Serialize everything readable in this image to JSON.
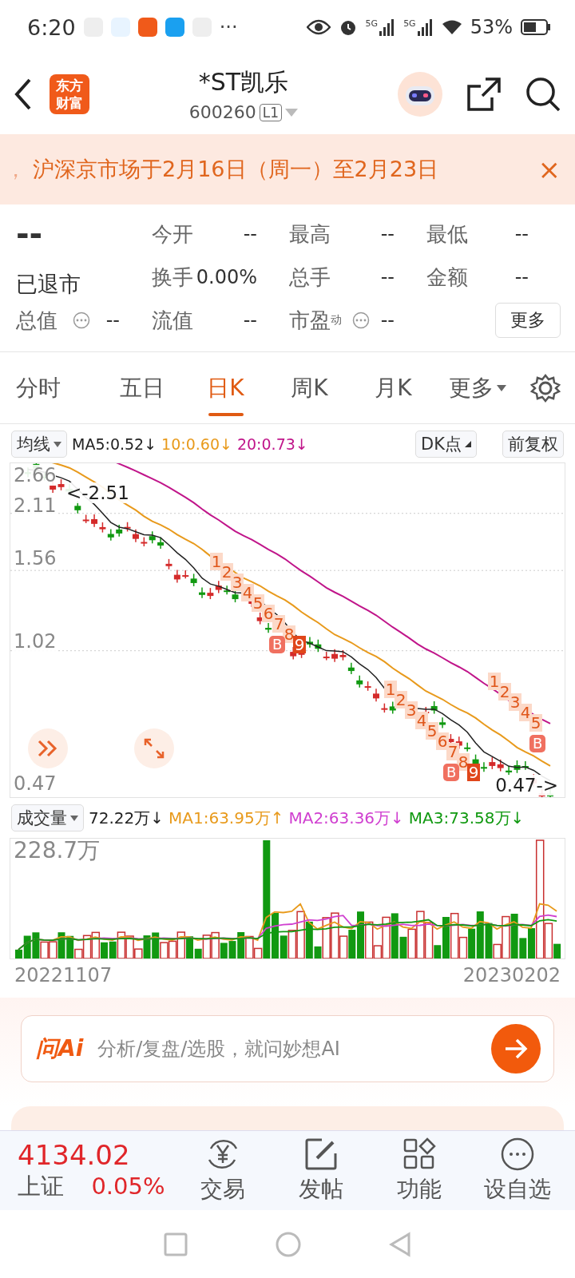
{
  "status_bar": {
    "time": "6:20",
    "more": "···",
    "network_1": "5G",
    "network_2": "5G",
    "battery": "53%"
  },
  "header": {
    "logo": "东方财富",
    "title": "*ST凯乐",
    "code": "600260",
    "level_badge": "L1"
  },
  "notice": {
    "lead": "，",
    "text": "沪深京市场于2月16日（周一）至2月23日",
    "close": "×"
  },
  "quote": {
    "price": "--",
    "status": "已退市",
    "fields": [
      {
        "label": "今开",
        "value": "--"
      },
      {
        "label": "最高",
        "value": "--"
      },
      {
        "label": "最低",
        "value": "--"
      },
      {
        "label": "换手",
        "value": "0.00%"
      },
      {
        "label": "总手",
        "value": "--"
      },
      {
        "label": "金额",
        "value": "--"
      }
    ],
    "row3": [
      {
        "label": "总值",
        "info": true,
        "value": "--"
      },
      {
        "label": "流值",
        "info": false,
        "value": "--"
      },
      {
        "label": "市盈",
        "sup": "动",
        "info": true,
        "value": "--"
      }
    ],
    "more_button": "更多"
  },
  "tabs": [
    {
      "label": "分时",
      "selected": false
    },
    {
      "label": "五日",
      "selected": false
    },
    {
      "label": "日K",
      "selected": true
    },
    {
      "label": "周K",
      "selected": false
    },
    {
      "label": "月K",
      "selected": false
    },
    {
      "label": "更多",
      "selected": false,
      "dropdown": true
    }
  ],
  "ma_bar": {
    "selector": "均线",
    "items": [
      {
        "text": "MA5:0.52↓",
        "color": "#222222"
      },
      {
        "text": "10:0.60↓",
        "color": "#e89a1c"
      },
      {
        "text": "20:0.73↓",
        "color": "#c0158a"
      }
    ],
    "dk_button": "DK点",
    "adjust_button": "前复权"
  },
  "kline": {
    "y_labels": [
      "2.66",
      "2.11",
      "1.56",
      "1.02",
      "0.47"
    ],
    "high_note": "<-2.51",
    "low_note": "0.47->",
    "td_sequences": [
      {
        "labels": [
          "1",
          "2",
          "3",
          "4",
          "5",
          "6",
          "7",
          "8",
          "9"
        ],
        "buy": "B"
      },
      {
        "labels": [
          "1",
          "2",
          "3",
          "4",
          "5",
          "6",
          "7",
          "8",
          "9"
        ],
        "buy": "B"
      },
      {
        "labels": [
          "1",
          "2",
          "3",
          "4",
          "5"
        ],
        "buy": "B"
      }
    ]
  },
  "volume_bar": {
    "selector": "成交量",
    "items": [
      {
        "text": "72.22万↓",
        "color": "#222222"
      },
      {
        "text": "MA1:63.95万↑",
        "color": "#e89a1c"
      },
      {
        "text": "MA2:63.36万↓",
        "color": "#d040d0"
      },
      {
        "text": "MA3:73.58万↓",
        "color": "#119911"
      }
    ]
  },
  "volume": {
    "max_label": "228.7万",
    "start_date": "20221107",
    "end_date": "20230202"
  },
  "ask_ai": {
    "brand": "问Ai",
    "placeholder": "分析/复盘/选股，就问妙想AI"
  },
  "bottom_bar": {
    "index_value": "4134.02",
    "index_name": "上证",
    "index_change": "0.05%",
    "actions": [
      {
        "label": "交易"
      },
      {
        "label": "发帖"
      },
      {
        "label": "功能"
      },
      {
        "label": "设自选"
      }
    ]
  }
}
